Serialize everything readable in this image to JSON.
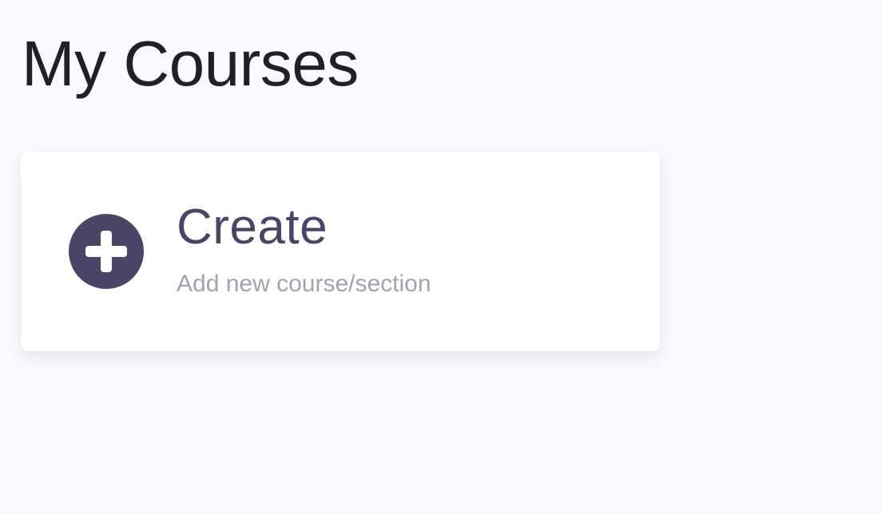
{
  "page": {
    "title": "My Courses"
  },
  "create_card": {
    "title": "Create",
    "subtitle": "Add new course/section",
    "icon": "plus-circle-icon",
    "accent_color": "#4a4566"
  }
}
